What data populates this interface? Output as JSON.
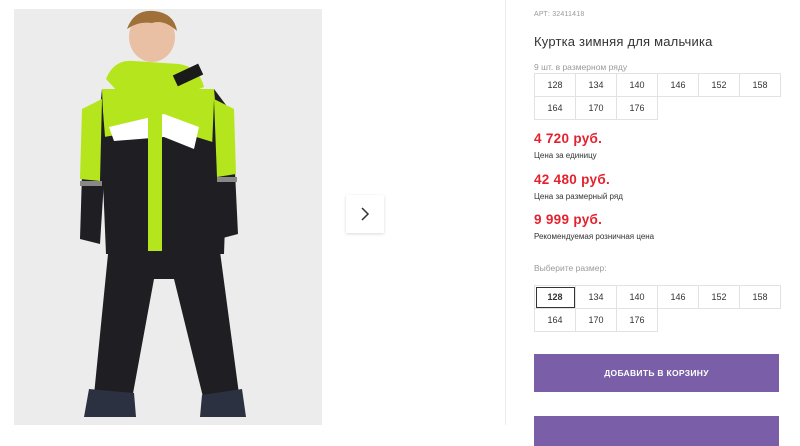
{
  "product": {
    "article": "АРТ: 32411418",
    "title": "Куртка зимняя для мальчика",
    "pack_note": "9 шт. в размерном ряду",
    "pack_sizes": [
      "128",
      "134",
      "140",
      "146",
      "152",
      "158",
      "164",
      "170",
      "176"
    ],
    "prices": [
      {
        "value": "4 720 руб.",
        "label": "Цена за единицу"
      },
      {
        "value": "42 480 руб.",
        "label": "Цена за размерный ряд"
      },
      {
        "value": "9 999 руб.",
        "label": "Рекомендуемая розничная цена"
      }
    ],
    "choose_label": "Выберите размер:",
    "choose_sizes": [
      "128",
      "134",
      "140",
      "146",
      "152",
      "158",
      "164",
      "170",
      "176"
    ],
    "selected_size": "128",
    "add_to_cart": "ДОБАВИТЬ В КОРЗИНУ"
  },
  "gallery": {
    "next_icon": "chevron-right-icon"
  },
  "colors": {
    "price": "#e4222e",
    "button": "#7a5fa8",
    "jacket_accent": "#b5e61d"
  }
}
